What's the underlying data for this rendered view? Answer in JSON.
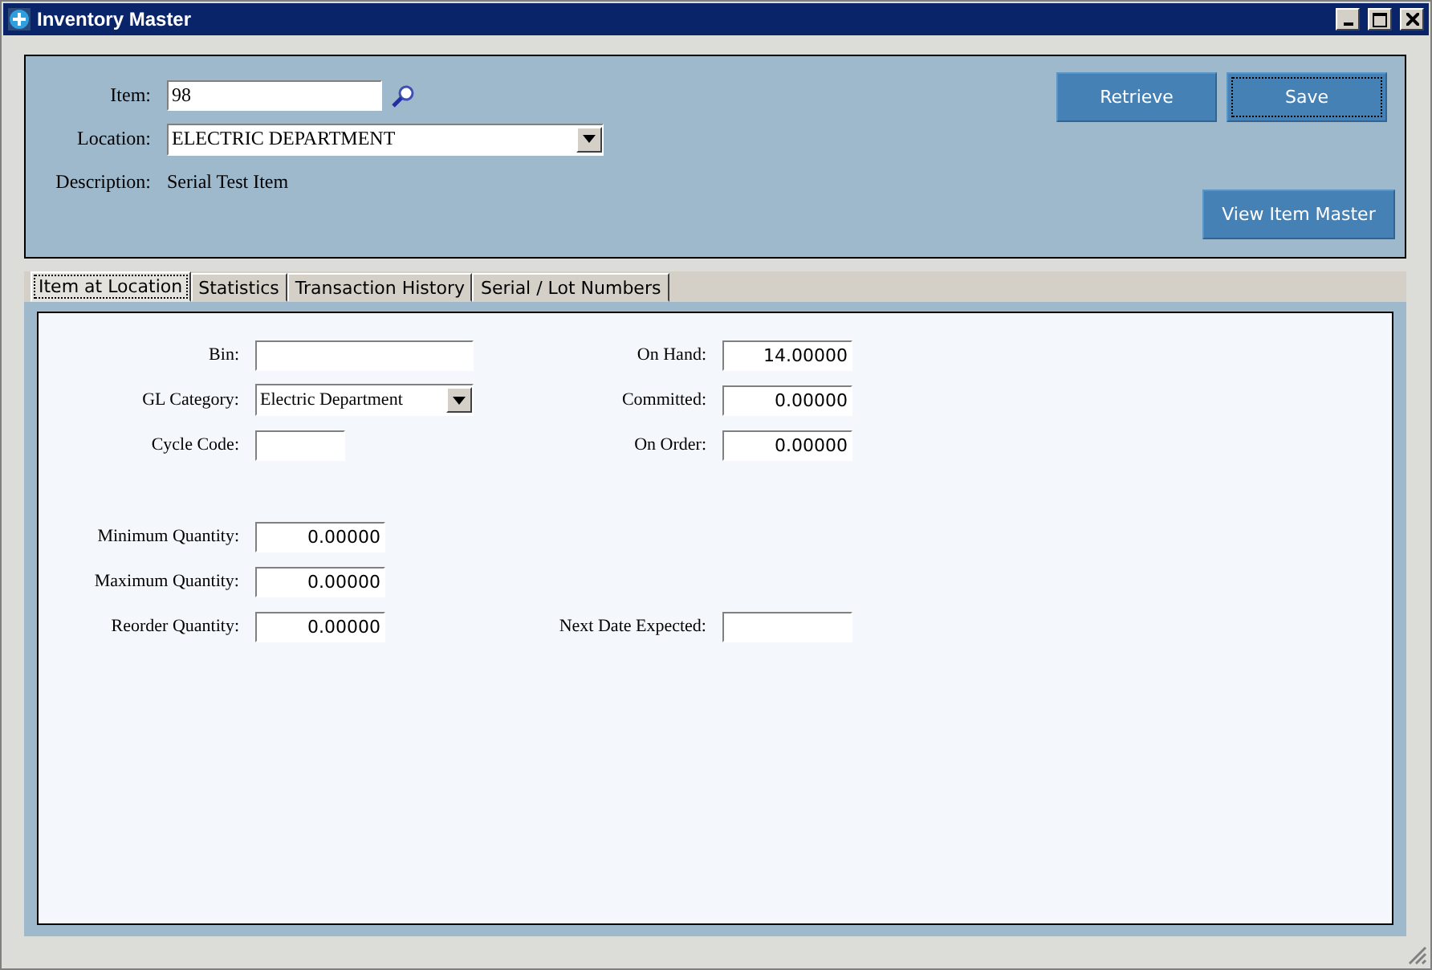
{
  "window": {
    "title": "Inventory Master"
  },
  "header": {
    "item": {
      "label": "Item:",
      "value": "98"
    },
    "location": {
      "label": "Location:",
      "value": "ELECTRIC DEPARTMENT"
    },
    "description": {
      "label": "Description:",
      "value": "Serial Test Item"
    },
    "buttons": [
      {
        "label": "Retrieve",
        "focused": false
      },
      {
        "label": "Save",
        "focused": true
      }
    ],
    "view_button": {
      "label": "View Item Master"
    }
  },
  "tabs": [
    {
      "label": "Item at Location",
      "selected": true
    },
    {
      "label": "Statistics",
      "selected": false
    },
    {
      "label": "Transaction History",
      "selected": false
    },
    {
      "label": "Serial / Lot Numbers",
      "selected": false
    }
  ],
  "groups": [
    {
      "rows": [
        {
          "left": {
            "label": "Bin:",
            "kind": "text"
          },
          "right": {
            "label": "On Hand:",
            "kind": "number",
            "value": "14.00000"
          }
        },
        {
          "left": {
            "label": "GL Category:",
            "kind": "dropdown",
            "value": "Electric Department"
          },
          "right": {
            "label": "Committed:",
            "kind": "number",
            "value": "0.00000"
          }
        },
        {
          "left": {
            "label": "Cycle Code:",
            "kind": "code"
          },
          "right": {
            "label": "On Order:",
            "kind": "number",
            "value": "0.00000"
          }
        }
      ]
    },
    {
      "rows": [
        {
          "left": {
            "label": "Minimum Quantity:",
            "kind": "number",
            "value": "0.00000"
          }
        },
        {
          "left": {
            "label": "Maximum Quantity:",
            "kind": "number",
            "value": "0.00000"
          }
        },
        {
          "left": {
            "label": "Reorder Quantity:",
            "kind": "number",
            "value": "0.00000"
          },
          "right": {
            "label": "Next Date Expected:",
            "kind": "date"
          }
        }
      ]
    }
  ]
}
